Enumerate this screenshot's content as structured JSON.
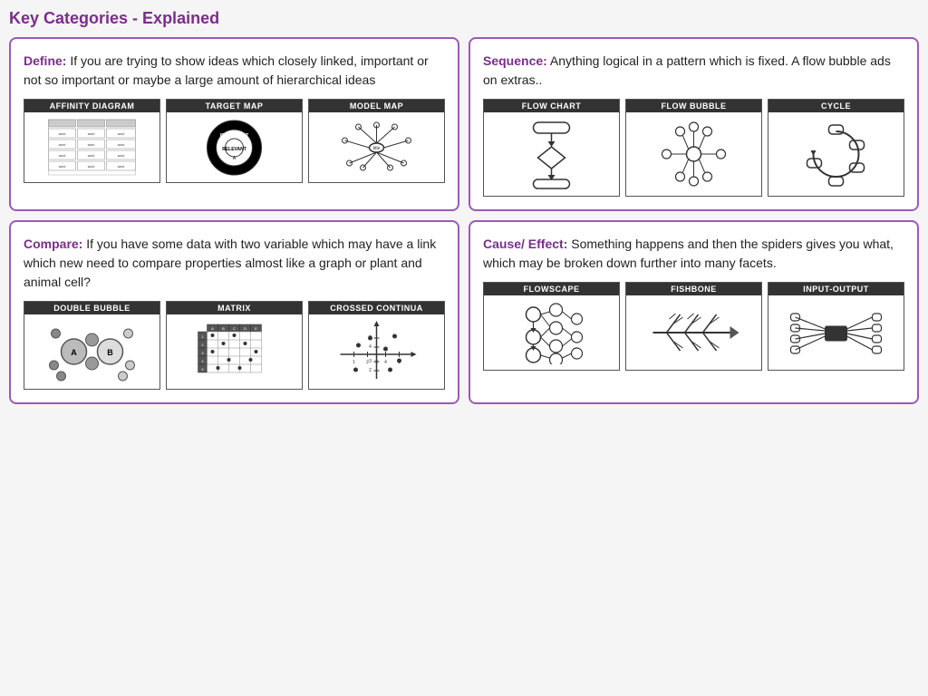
{
  "page": {
    "title": "Key Categories - Explained"
  },
  "cards": {
    "define": {
      "label": "Define:",
      "text": " If you are trying to show ideas which closely linked, important or not so important or maybe a large amount of hierarchical ideas",
      "diagrams": [
        {
          "label": "AFFINITY DIAGRAM"
        },
        {
          "label": "TARGET MAP"
        },
        {
          "label": "MODEL MAP"
        }
      ]
    },
    "sequence": {
      "label": "Sequence:",
      "text": " Anything logical in a pattern which is fixed. A flow bubble ads on extras..",
      "diagrams": [
        {
          "label": "FLOW CHART"
        },
        {
          "label": "FLOW BUBBLE"
        },
        {
          "label": "CYCLE"
        }
      ]
    },
    "compare": {
      "label": "Compare:",
      "text": " If you have some data with two variable which may have a link which new need to compare properties almost like a graph or plant and animal cell?",
      "diagrams": [
        {
          "label": "DOUBLE BUBBLE"
        },
        {
          "label": "MATRIX"
        },
        {
          "label": "CROSSED CONTINUA"
        }
      ]
    },
    "causeeffect": {
      "label": "Cause/ Effect:",
      "text": " Something happens and then the spiders gives you what, which may be broken down further into many facets.",
      "diagrams": [
        {
          "label": "FLOWSCAPE"
        },
        {
          "label": "FISHBONE"
        },
        {
          "label": "INPUT-OUTPUT"
        }
      ]
    }
  }
}
